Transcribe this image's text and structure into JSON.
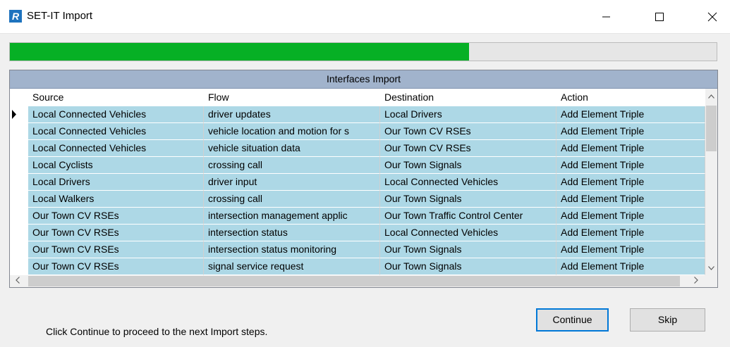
{
  "window": {
    "title": "SET-IT Import",
    "app_icon_letter": "R",
    "controls": [
      "minimize-icon",
      "maximize-icon",
      "close-icon"
    ]
  },
  "progress": {
    "percent": 65,
    "color": "#06b025"
  },
  "grid": {
    "caption": "Interfaces Import",
    "columns": [
      "Source",
      "Flow",
      "Destination",
      "Action"
    ],
    "rows": [
      {
        "source": "Local Connected Vehicles",
        "flow": "driver updates",
        "destination": "Local Drivers",
        "action": "Add Element Triple",
        "current": true
      },
      {
        "source": "Local Connected Vehicles",
        "flow": "vehicle location and motion for s",
        "destination": "Our Town CV RSEs",
        "action": "Add Element Triple"
      },
      {
        "source": "Local Connected Vehicles",
        "flow": "vehicle situation data",
        "destination": "Our Town CV RSEs",
        "action": "Add Element Triple"
      },
      {
        "source": "Local Cyclists",
        "flow": "crossing call",
        "destination": "Our Town Signals",
        "action": "Add Element Triple"
      },
      {
        "source": "Local Drivers",
        "flow": "driver input",
        "destination": "Local Connected Vehicles",
        "action": "Add Element Triple"
      },
      {
        "source": "Local Walkers",
        "flow": "crossing call",
        "destination": "Our Town Signals",
        "action": "Add Element Triple"
      },
      {
        "source": "Our Town CV RSEs",
        "flow": "intersection management applic",
        "destination": "Our Town Traffic Control Center",
        "action": "Add Element Triple"
      },
      {
        "source": "Our Town CV RSEs",
        "flow": "intersection status",
        "destination": "Local Connected Vehicles",
        "action": "Add Element Triple"
      },
      {
        "source": "Our Town CV RSEs",
        "flow": "intersection status monitoring",
        "destination": "Our Town Signals",
        "action": "Add Element Triple"
      },
      {
        "source": "Our Town CV RSEs",
        "flow": "signal service request",
        "destination": "Our Town Signals",
        "action": "Add Element Triple"
      }
    ],
    "row_color": "#add8e6",
    "caption_color": "#a1b3cc"
  },
  "footer": {
    "message": "Click Continue to proceed to the next Import steps.",
    "continue_label": "Continue",
    "skip_label": "Skip"
  }
}
